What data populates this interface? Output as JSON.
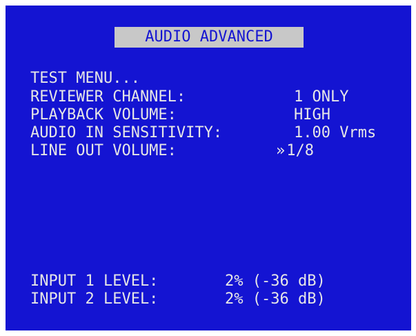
{
  "title": "AUDIO ADVANCED",
  "menu": {
    "test_menu": "TEST MENU...",
    "reviewer_channel": {
      "label": "REVIEWER CHANNEL:",
      "value": "1 ONLY"
    },
    "playback_volume": {
      "label": "PLAYBACK VOLUME:",
      "value": "HIGH"
    },
    "audio_in_sensitivity": {
      "label": "AUDIO IN SENSITIVITY:",
      "value": "1.00 Vrms"
    },
    "line_out_volume": {
      "label": "LINE OUT VOLUME:",
      "cursor": "»",
      "value": "1/8"
    }
  },
  "levels": {
    "input1": {
      "label": "INPUT 1 LEVEL:",
      "value": "2% (-36 dB)"
    },
    "input2": {
      "label": "INPUT 2 LEVEL:",
      "value": "2% (-36 dB)"
    }
  },
  "colors": {
    "background": "#1414d2",
    "text": "#e6e6e6",
    "title_bg": "#c8c8c8"
  }
}
